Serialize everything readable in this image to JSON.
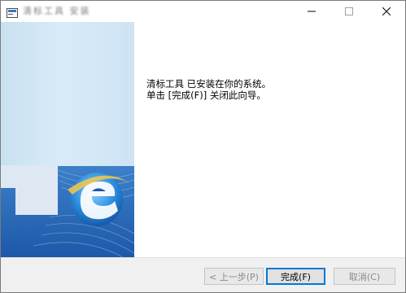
{
  "window": {
    "title": "清标工具 安装",
    "icon": "installer-icon",
    "controls": {
      "minimize": "minimize-icon",
      "maximize": "maximize-icon",
      "close": "close-icon"
    }
  },
  "sidebar": {
    "graphic": "ie-logo-banner"
  },
  "content": {
    "line1": "清标工具 已安装在你的系统。",
    "line2": "单击 [完成(F)] 关闭此向导。"
  },
  "buttons": {
    "back": "< 上一步(P)",
    "finish": "完成(F)",
    "cancel": "取消(C)"
  },
  "colors": {
    "accent": "#0078d7",
    "sidebar": "#d0e5f5",
    "footer": "#f0f0f0"
  }
}
